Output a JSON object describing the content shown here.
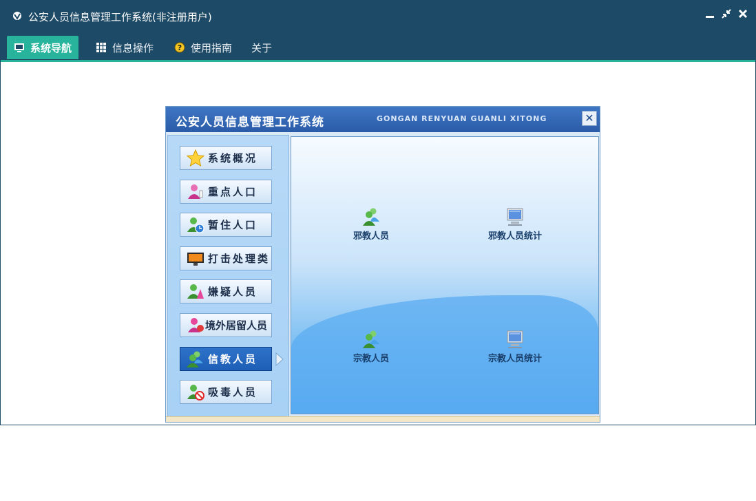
{
  "window": {
    "title": "公安人员信息管理工作系统(非注册用户)"
  },
  "menu": [
    {
      "label": "系统导航",
      "icon": "monitor-icon",
      "active": true
    },
    {
      "label": "信息操作",
      "icon": "grid-icon",
      "active": false
    },
    {
      "label": "使用指南",
      "icon": "help-icon",
      "active": false
    },
    {
      "label": "关于",
      "icon": "",
      "active": false
    }
  ],
  "app": {
    "title": "公安人员信息管理工作系统",
    "subtitle": "GONGAN RENYUAN GUANLI XITONG",
    "close_label": "✕"
  },
  "sidebar": [
    {
      "label": "系统概况",
      "icon": "star-icon"
    },
    {
      "label": "重点人口",
      "icon": "user-alert-icon"
    },
    {
      "label": "暂住人口",
      "icon": "user-clock-icon"
    },
    {
      "label": "打击处理类",
      "icon": "monitor-icon"
    },
    {
      "label": "嫌疑人员",
      "icon": "user-alert-icon"
    },
    {
      "label": "境外居留人员",
      "icon": "user-group-icon"
    },
    {
      "label": "信教人员",
      "icon": "users-icon",
      "active": true
    },
    {
      "label": "吸毒人员",
      "icon": "user-forbidden-icon"
    }
  ],
  "main_items": [
    {
      "label": "邪教人员",
      "icon": "users-icon"
    },
    {
      "label": "邪教人员统计",
      "icon": "computer-icon"
    },
    {
      "label": "宗教人员",
      "icon": "users-icon"
    },
    {
      "label": "宗教人员统计",
      "icon": "computer-icon"
    }
  ],
  "colors": {
    "titlebar": "#1d4a67",
    "accent": "#27b39c",
    "active_button": "#2f72c9"
  }
}
